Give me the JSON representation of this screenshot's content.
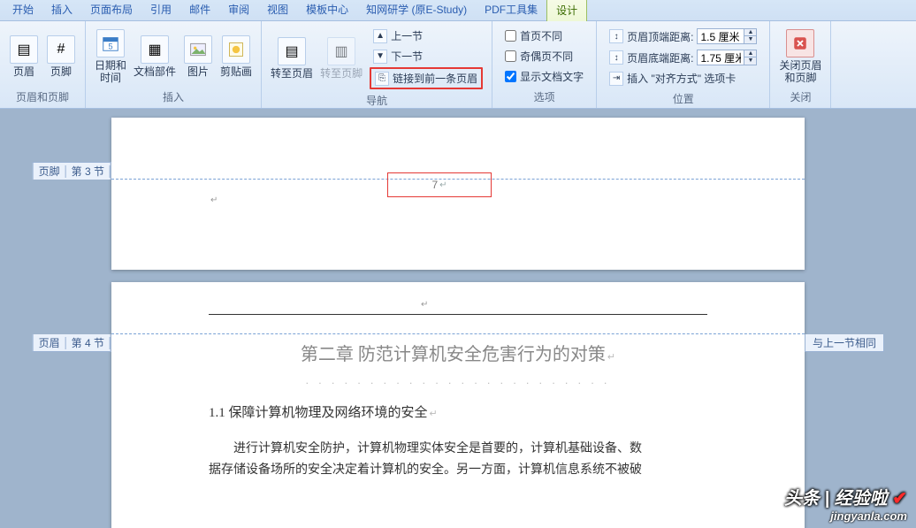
{
  "tabs": {
    "items": [
      {
        "label": "开始"
      },
      {
        "label": "插入"
      },
      {
        "label": "页面布局"
      },
      {
        "label": "引用"
      },
      {
        "label": "邮件"
      },
      {
        "label": "审阅"
      },
      {
        "label": "视图"
      },
      {
        "label": "模板中心"
      },
      {
        "label": "知网研学 (原E-Study)"
      },
      {
        "label": "PDF工具集"
      },
      {
        "label": "设计"
      }
    ],
    "active": 10
  },
  "ribbon": {
    "group_hf": {
      "label": "页眉和页脚",
      "header_btn": "页眉",
      "footer_btn": "页脚"
    },
    "group_insert": {
      "label": "插入",
      "datetime": "日期和\n时间",
      "docparts": "文档部件",
      "picture": "图片",
      "clipart": "剪贴画"
    },
    "group_nav": {
      "label": "导航",
      "to_header": "转至页眉",
      "to_footer": "转至页脚",
      "prev_section": "上一节",
      "next_section": "下一节",
      "link_previous": "链接到前一条页眉"
    },
    "group_options": {
      "label": "选项",
      "first_diff": "首页不同",
      "odd_even_diff": "奇偶页不同",
      "show_doc_text": "显示文档文字"
    },
    "group_position": {
      "label": "位置",
      "header_dist_label": "页眉顶端距离:",
      "footer_dist_label": "页眉底端距离:",
      "header_dist_value": "1.5 厘米",
      "footer_dist_value": "1.75 厘米",
      "insert_align_tab": "插入 \"对齐方式\" 选项卡"
    },
    "group_close": {
      "label": "关闭",
      "close_btn": "关闭页眉\n和页脚"
    }
  },
  "doc": {
    "footer_tag_section": "页脚",
    "footer_tag_num": "第 3 节",
    "footer_page_number": "7",
    "header_tag_section": "页眉",
    "header_tag_num": "第 4 节",
    "same_as_prev": "与上一节相同",
    "chapter_title": "第二章  防范计算机安全危害行为的对策",
    "sub_title": "1.1 保障计算机物理及网络环境的安全",
    "body_line1": "进行计算机安全防护，计算机物理实体安全是首要的，计算机基础设备、数",
    "body_line2": "据存储设备场所的安全决定着计算机的安全。另一方面，计算机信息系统不被破"
  },
  "watermark": {
    "line1_a": "头条",
    "line1_b": "经验啦",
    "line2": "jingyanla.com"
  }
}
